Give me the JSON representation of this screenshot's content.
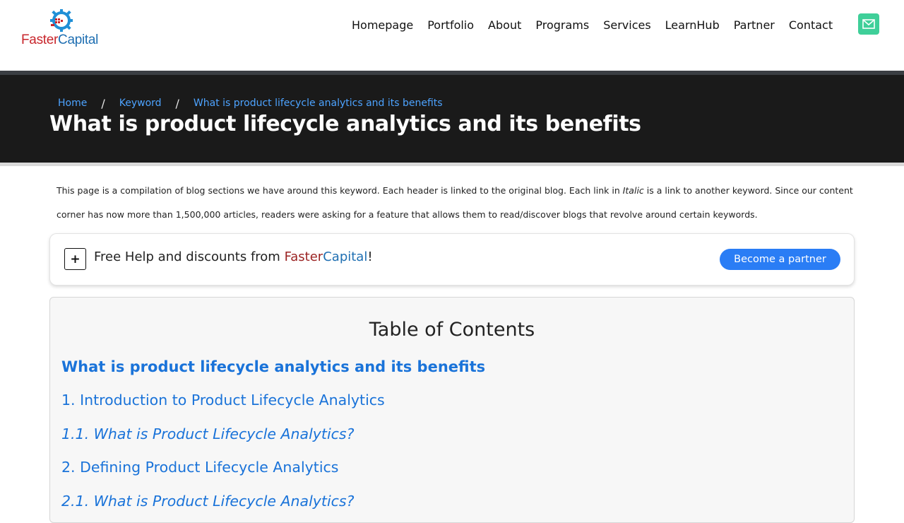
{
  "header": {
    "logo": {
      "part1": "Faster",
      "part2": "Capital"
    },
    "nav": [
      "Homepage",
      "Portfolio",
      "About",
      "Programs",
      "Services",
      "LearnHub",
      "Partner",
      "Contact"
    ],
    "contact_icon": "mail-icon"
  },
  "breadcrumb": {
    "home": "Home",
    "keyword": "Keyword",
    "current": "What is product lifecycle analytics and its benefits",
    "separator": "/"
  },
  "page_title": "What is product lifecycle analytics and its benefits",
  "intro": {
    "part1": "This page is a compilation of blog sections we have around this keyword. Each header is linked to the original blog. Each link in ",
    "italic_word": "Italic",
    "part2": " is a link to another keyword. Since our content corner has now more than 1,500,000 articles, readers were asking for a feature that allows them to read/discover blogs that revolve around certain keywords."
  },
  "help_box": {
    "plus_symbol": "+",
    "text_before": "Free Help and discounts from ",
    "brand_part1": "Faster",
    "brand_part2": "Capital",
    "text_after": "!",
    "button_label": "Become a partner"
  },
  "toc": {
    "title": "Table of Contents",
    "main_link": "What is product lifecycle analytics and its benefits",
    "items": [
      {
        "label": "1. Introduction to Product Lifecycle Analytics",
        "level": 1
      },
      {
        "label": "1.1. What is Product Lifecycle Analytics?",
        "level": 2
      },
      {
        "label": "2. Defining Product Lifecycle Analytics",
        "level": 1
      },
      {
        "label": "2.1. What is Product Lifecycle Analytics?",
        "level": 2
      }
    ]
  },
  "colors": {
    "hero_bg": "#1a1a1a",
    "link_blue": "#1a73d9",
    "breadcrumb_blue": "#4da3ff",
    "partner_button": "#2a7df5",
    "mail_button": "#3fcf99",
    "brand_red": "#c8262c",
    "brand_blue": "#1f6fb2"
  }
}
